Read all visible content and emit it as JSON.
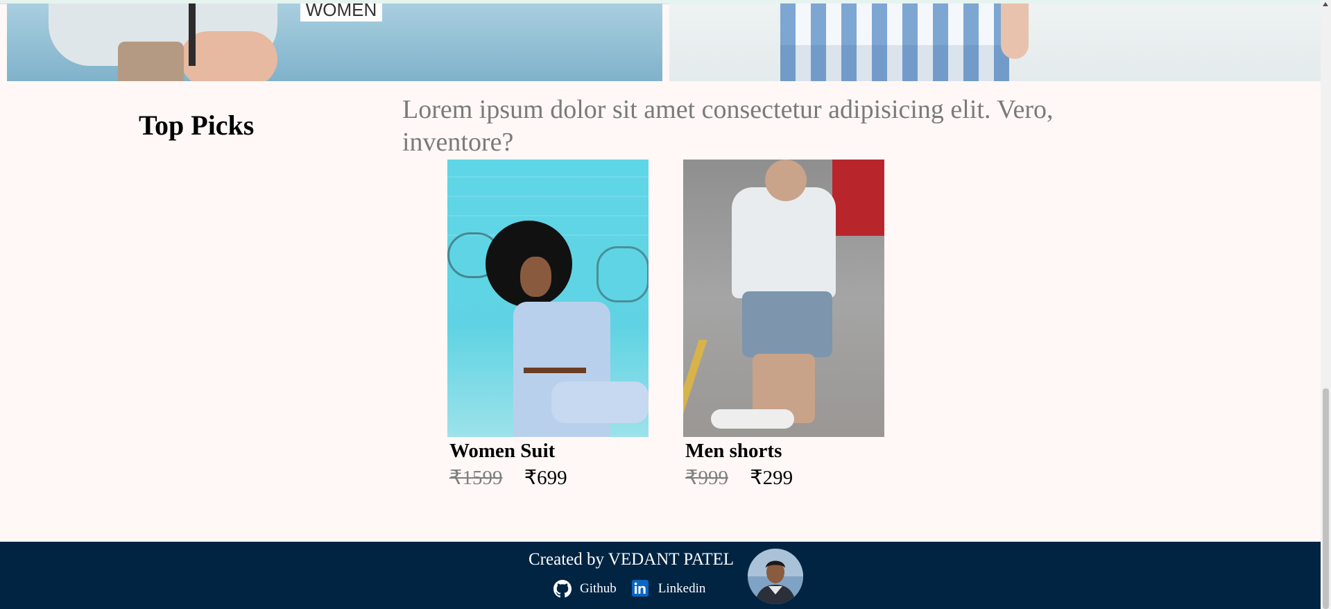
{
  "banners": {
    "women_label": "WOMEN"
  },
  "top_picks": {
    "title": "Top Picks",
    "description": "Lorem ipsum dolor sit amet consectetur adipisicing elit. Vero, inventore?",
    "products": [
      {
        "name": "Women Suit",
        "old_price": "₹1599",
        "new_price": "₹699"
      },
      {
        "name": "Men shorts",
        "old_price": "₹999",
        "new_price": "₹299"
      }
    ]
  },
  "footer": {
    "credit": "Created by VEDANT PATEL",
    "links": [
      {
        "label": "Github",
        "icon": "github-icon"
      },
      {
        "label": "Linkedin",
        "icon": "linkedin-icon"
      }
    ],
    "avatar": "creator-avatar"
  },
  "colors": {
    "page_background": "#fff8f7",
    "footer_background": "#012443",
    "muted_text": "#7a7a7a",
    "linkedin_blue": "#0a66c2"
  }
}
